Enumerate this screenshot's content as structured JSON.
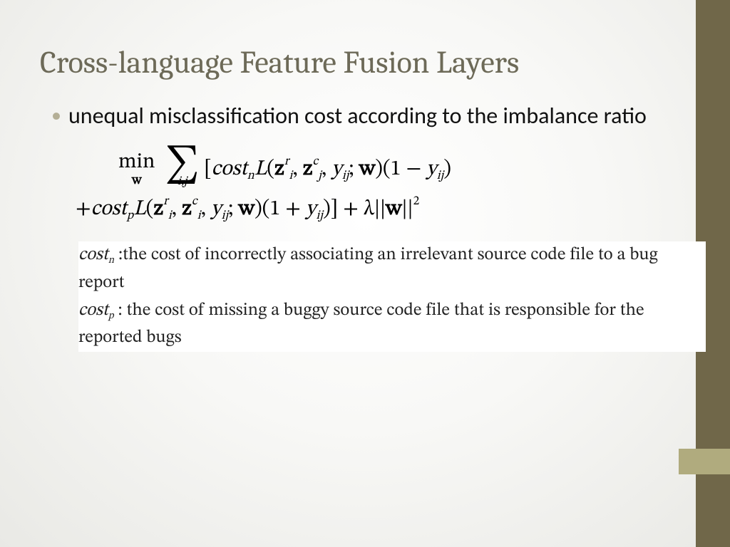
{
  "title": "Cross-language Feature Fusion Layers",
  "bullet": "unequal misclassification cost according to the imbalance ratio",
  "eq": {
    "min": "min",
    "w": "w",
    "sigma": "∑",
    "sum_sub": "i,j",
    "line1_a": "[",
    "costn": "cost",
    "n": "n",
    "L": "L",
    "lp": "(",
    "z": "z",
    "r": "r",
    "i": "i",
    "c": "c",
    "j": "j",
    "comma": ",",
    "y": "y",
    "ij": "ij",
    "semi": ";",
    "rp": ")",
    "one_minus": "(1 − ",
    "plus_costp": "+",
    "costp": "cost",
    "p": "p",
    "one_plus": "(1 + ",
    "rb": ")]",
    "plus_lambda": " + λ||",
    "wnorm_end": "||",
    "sq": "2"
  },
  "desc": {
    "costn_label": "cost",
    "n": "n",
    "costn_text": " :the cost of incorrectly associating an irrelevant source code file to a bug report",
    "costp_label": "cost",
    "p": "p",
    "costp_text": " : the cost of missing a buggy source code file that is respon­sible for the reported bugs"
  }
}
